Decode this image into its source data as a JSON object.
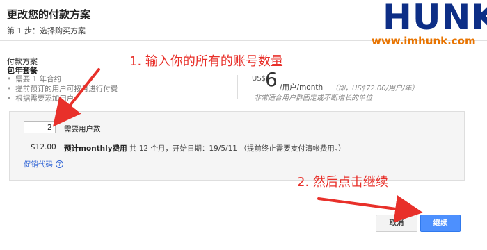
{
  "header": {
    "title": "更改您的付款方案",
    "step": "第 1 步：选择购买方案"
  },
  "plan": {
    "section_label": "付款方案",
    "name": "包年套餐",
    "features": [
      "需要 1 年合约",
      "提前预订的用户可按月进行付费",
      "根据需要添加用户"
    ],
    "currency": "US$",
    "amount": "6",
    "unit": "/用户/month",
    "yearly": "（即，US$72.00/用户/年）",
    "note": "非常适合用户群固定或不断增长的单位"
  },
  "config": {
    "user_count_value": "2",
    "user_count_label": "需要用户数",
    "billing_amount": "$12.00",
    "billing_prefix": "预计monthly费用",
    "billing_detail": " 共 12 个月，开始日期：19/5/11 （提前终止需要支付清帐费用。）",
    "promo_link": "促销代码",
    "help_icon": "?"
  },
  "actions": {
    "cancel_label": "取消",
    "continue_label": "继续"
  },
  "annotations": {
    "step_1": "1. 输入你的所有的账号数量",
    "step_2": "2. 然后点击继续",
    "arrow_color": "#e8302a"
  },
  "watermark": {
    "logo": "HUNK",
    "url": "www.imhunk.com"
  },
  "colors": {
    "primary_button": "#4d90fe",
    "link": "#3367d6",
    "annotation": "#e8302a",
    "logo_blue": "#0d2e86",
    "logo_orange": "#f28a00"
  }
}
